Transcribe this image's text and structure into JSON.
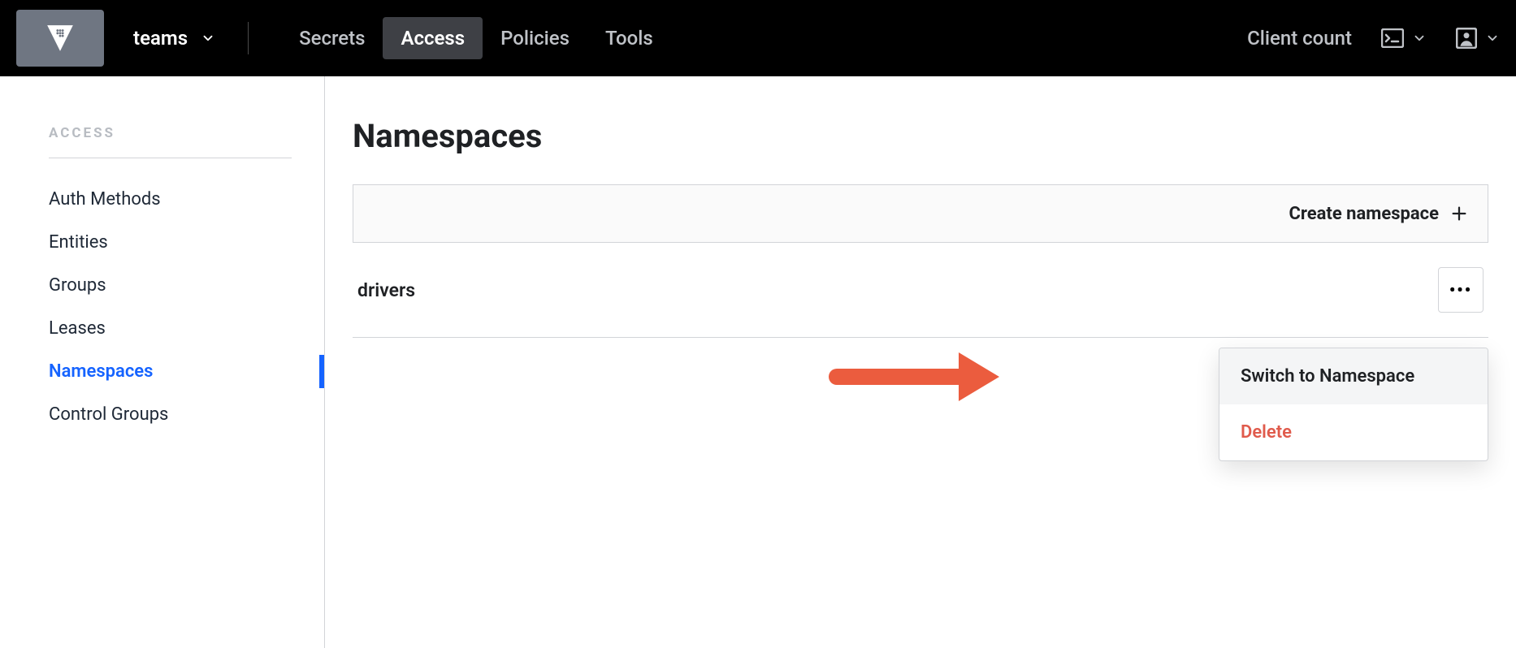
{
  "topbar": {
    "namespace": "teams",
    "nav": [
      {
        "label": "Secrets",
        "active": false
      },
      {
        "label": "Access",
        "active": true
      },
      {
        "label": "Policies",
        "active": false
      },
      {
        "label": "Tools",
        "active": false
      }
    ],
    "client_count": "Client count"
  },
  "sidebar": {
    "heading": "ACCESS",
    "items": [
      {
        "label": "Auth Methods",
        "active": false
      },
      {
        "label": "Entities",
        "active": false
      },
      {
        "label": "Groups",
        "active": false
      },
      {
        "label": "Leases",
        "active": false
      },
      {
        "label": "Namespaces",
        "active": true
      },
      {
        "label": "Control Groups",
        "active": false
      }
    ]
  },
  "page": {
    "title": "Namespaces",
    "create_label": "Create namespace",
    "rows": [
      {
        "name": "drivers"
      }
    ],
    "menu": {
      "switch": "Switch to Namespace",
      "delete": "Delete"
    }
  },
  "colors": {
    "accent": "#1563ff",
    "danger": "#e05b4c",
    "arrow": "#eb5c3e"
  }
}
